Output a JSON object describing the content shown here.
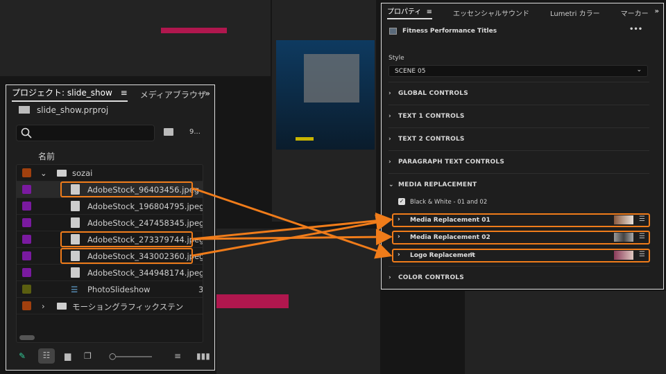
{
  "colors": {
    "highlight": "#f07c1a",
    "accent_clip": "#b0174e",
    "swatch_orange": "#a0400e",
    "swatch_purple": "#7a1aa0",
    "swatch_olive": "#5a5e10"
  },
  "project": {
    "tabs": [
      {
        "label": "プロジェクト: slide_show",
        "active": true
      },
      {
        "label": "メディアブラウザ"
      }
    ],
    "menu_icon": "≡",
    "overflow": "»",
    "file": "slide_show.prproj",
    "search_placeholder": "",
    "count": "9...",
    "column_name": "名前",
    "rows": [
      {
        "label": "sozai",
        "type": "folder",
        "expanded": true,
        "color": "#a0400e"
      },
      {
        "label": "AdobeStock_96403456.jpeg",
        "type": "image",
        "color": "#7a1aa0",
        "highlighted": true
      },
      {
        "label": "AdobeStock_196804795.jpeg",
        "type": "image",
        "color": "#7a1aa0"
      },
      {
        "label": "AdobeStock_247458345.jpeg",
        "type": "image",
        "color": "#7a1aa0"
      },
      {
        "label": "AdobeStock_273379744.jpeg",
        "type": "image",
        "color": "#7a1aa0",
        "highlighted": true
      },
      {
        "label": "AdobeStock_343002360.jpeg",
        "type": "image",
        "color": "#7a1aa0",
        "highlighted": true
      },
      {
        "label": "AdobeStock_344948174.jpeg",
        "type": "image",
        "color": "#7a1aa0"
      },
      {
        "label": "PhotoSlideshow",
        "type": "sequence",
        "color": "#5a5e10",
        "extra": "3"
      },
      {
        "label": "モーションググラフィックステン",
        "type": "folder",
        "expanded": false,
        "color": "#a0400e"
      }
    ]
  },
  "properties": {
    "tabs": [
      {
        "label": "プロパティ",
        "active": true
      },
      {
        "label": "エッセンシャルサウンド"
      },
      {
        "label": "Lumetri カラー"
      },
      {
        "label": "マーカー"
      }
    ],
    "menu_icon": "≡",
    "overflow": "»",
    "title": "Fitness Performance Titles",
    "more": "•••",
    "style_label": "Style",
    "style_value": "SCENE 05",
    "sections": [
      "GLOBAL CONTROLS",
      "TEXT 1 CONTROLS",
      "TEXT 2 CONTROLS",
      "PARAGRAPH TEXT CONTROLS"
    ],
    "media_section": "MEDIA REPLACEMENT",
    "checkbox": {
      "label": "Black & White - 01 and 02",
      "checked": true
    },
    "media_items": [
      "Media Replacement 01",
      "Media Replacement 02",
      "Logo Replacement"
    ],
    "color_section": "COLOR CONTROLS"
  }
}
